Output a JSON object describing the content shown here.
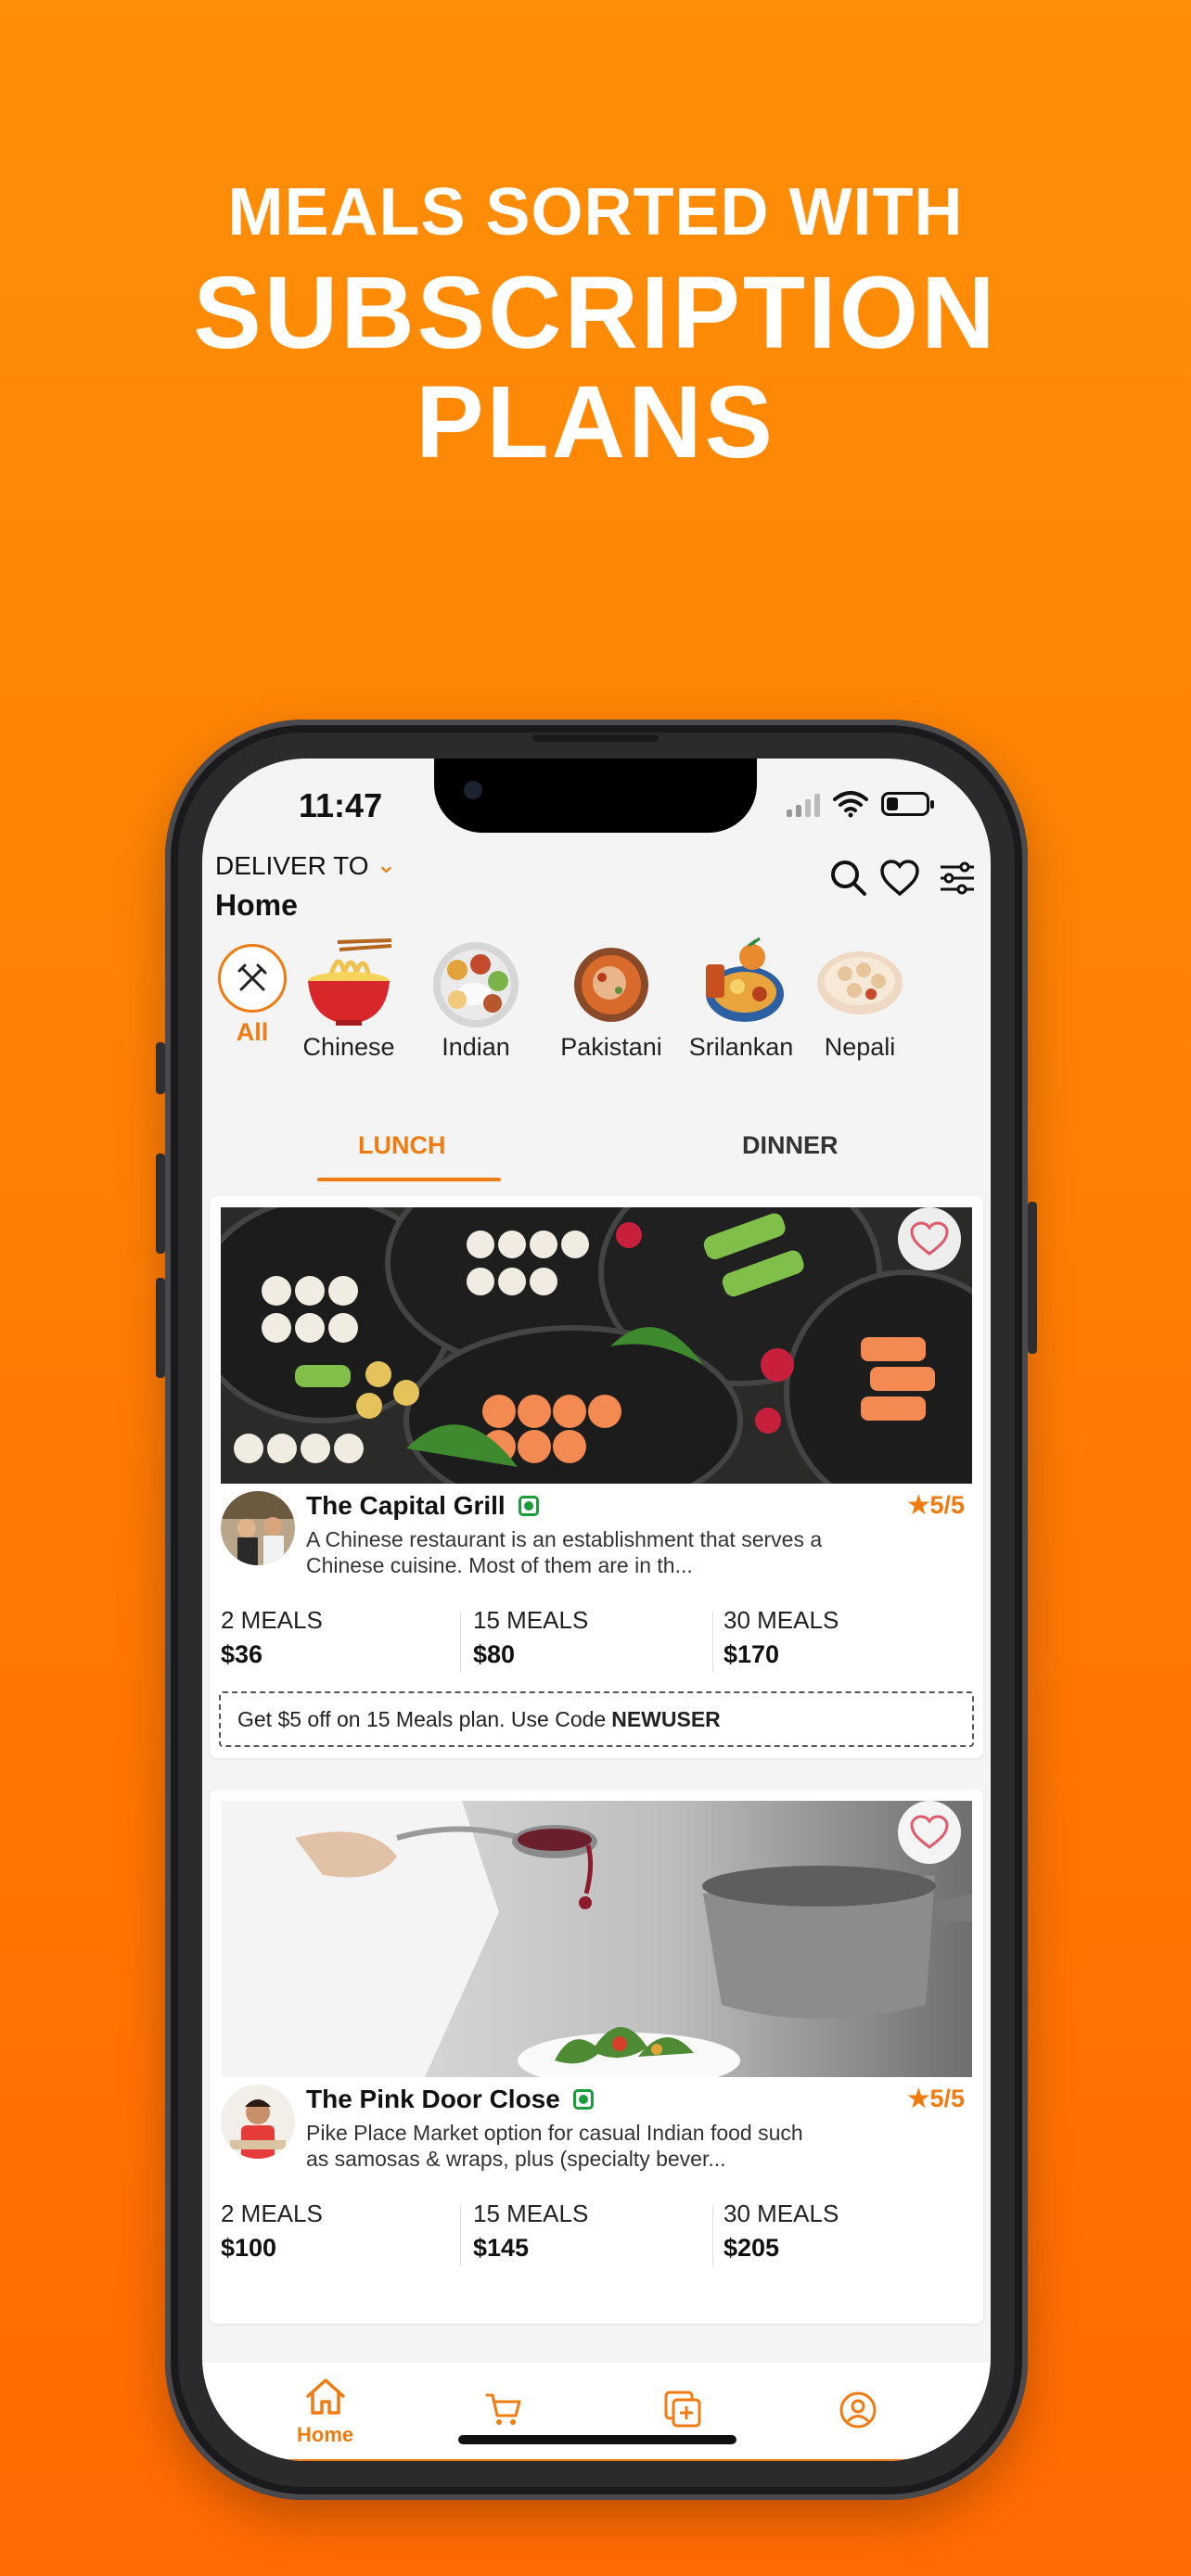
{
  "headline": {
    "line1": "MEALS SORTED WITH",
    "line2": "SUBSCRIPTION",
    "line3": "PLANS"
  },
  "status_bar": {
    "time": "11:47",
    "battery_level": 0.3
  },
  "header": {
    "deliver_label": "DELIVER TO",
    "address": "Home"
  },
  "categories": [
    {
      "label": "All",
      "selected": true
    },
    {
      "label": "Chinese"
    },
    {
      "label": "Indian"
    },
    {
      "label": "Pakistani"
    },
    {
      "label": "Srilankan"
    },
    {
      "label": "Nepali"
    }
  ],
  "tabs": [
    {
      "label": "LUNCH",
      "active": true
    },
    {
      "label": "DINNER",
      "active": false
    }
  ],
  "restaurants": [
    {
      "name": "The Capital Grill",
      "rating": "★5/5",
      "description": "A Chinese restaurant is an establishment that serves a Chinese cuisine. Most of them are in th...",
      "plans": [
        {
          "label": "2 MEALS",
          "price": "$36"
        },
        {
          "label": "15 MEALS",
          "price": "$80"
        },
        {
          "label": "30 MEALS",
          "price": "$170"
        }
      ],
      "promo": {
        "text": "Get $5 off on 15 Meals plan. Use Code",
        "code": "NEWUSER"
      }
    },
    {
      "name": "The Pink Door Close",
      "rating": "★5/5",
      "description": "Pike Place Market option for casual Indian food such as samosas & wraps, plus (specialty bever...",
      "plans": [
        {
          "label": "2 MEALS",
          "price": "$100"
        },
        {
          "label": "15 MEALS",
          "price": "$145"
        },
        {
          "label": "30 MEALS",
          "price": "$205"
        }
      ]
    }
  ],
  "bottom_nav": {
    "home_label": "Home",
    "items": [
      "home-icon",
      "cart-icon",
      "subscriptions-icon",
      "profile-icon"
    ]
  },
  "colors": {
    "accent": "#f07b10",
    "background_top": "#ff8f06",
    "background_bottom": "#ff6a02",
    "veg_green": "#1a9c3a"
  }
}
